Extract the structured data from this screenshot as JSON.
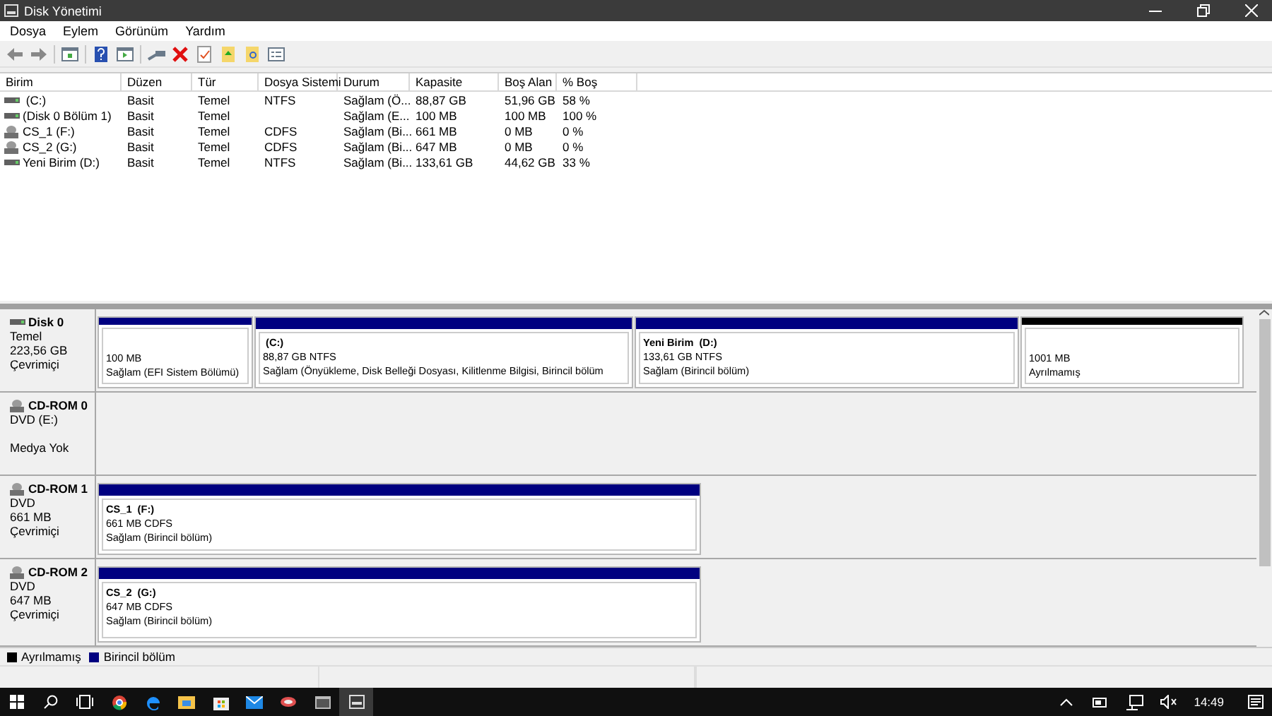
{
  "window": {
    "title": "Disk Yönetimi"
  },
  "menu": [
    "Dosya",
    "Eylem",
    "Görünüm",
    "Yardım"
  ],
  "volume_table": {
    "columns": [
      "Birim",
      "Düzen",
      "Tür",
      "Dosya Sistemi",
      "Durum",
      "Kapasite",
      "Boş Alan",
      "% Boş"
    ],
    "rows": [
      {
        "kind": "disk",
        "cells": [
          " (C:)",
          "Basit",
          "Temel",
          "NTFS",
          "Sağlam (Ö...",
          "88,87 GB",
          "51,96 GB",
          "58 %"
        ]
      },
      {
        "kind": "disk",
        "cells": [
          "(Disk 0 Bölüm 1)",
          "Basit",
          "Temel",
          null,
          "Sağlam (E...",
          "100 MB",
          "100 MB",
          "100 %"
        ]
      },
      {
        "kind": "cd",
        "cells": [
          "CS_1 (F:)",
          "Basit",
          "Temel",
          "CDFS",
          "Sağlam (Bi...",
          "661 MB",
          "0 MB",
          "0 %"
        ]
      },
      {
        "kind": "cd",
        "cells": [
          "CS_2 (G:)",
          "Basit",
          "Temel",
          "CDFS",
          "Sağlam (Bi...",
          "647 MB",
          "0 MB",
          "0 %"
        ]
      },
      {
        "kind": "disk",
        "cells": [
          "Yeni Birim (D:)",
          "Basit",
          "Temel",
          "NTFS",
          "Sağlam (Bi...",
          "133,61 GB",
          "44,62 GB",
          "33 %"
        ]
      }
    ]
  },
  "disks": [
    {
      "kind": "disk",
      "name": "Disk 0",
      "lines": [
        "Temel",
        "223,56 GB",
        "Çevrimiçi"
      ],
      "partitions": [
        {
          "kind": "primary",
          "size": "100 MB",
          "status": "Sağlam (EFI Sistem Bölümü)"
        },
        {
          "kind": "primary",
          "title": " (C:)",
          "size": "88,87 GB NTFS",
          "status": "Sağlam (Önyükleme, Disk Belleği Dosyası, Kilitlenme Bilgisi, Birincil bölüm"
        },
        {
          "kind": "primary",
          "title": "Yeni Birim  (D:)",
          "size": "133,61 GB NTFS",
          "status": "Sağlam (Birincil bölüm)"
        },
        {
          "kind": "unallocated",
          "size": "1001 MB",
          "status": "Ayrılmamış"
        }
      ]
    },
    {
      "kind": "cd",
      "name": "CD-ROM 0",
      "lines": [
        "DVD (E:)"
      ],
      "note": "Medya Yok"
    },
    {
      "kind": "cd",
      "name": "CD-ROM 1",
      "lines": [
        "DVD",
        "661 MB",
        "Çevrimiçi"
      ],
      "partitions": [
        {
          "kind": "primary",
          "title": "CS_1  (F:)",
          "size": "661 MB CDFS",
          "status": "Sağlam (Birincil bölüm)"
        }
      ]
    },
    {
      "kind": "cd",
      "name": "CD-ROM 2",
      "lines": [
        "DVD",
        "647 MB",
        "Çevrimiçi"
      ],
      "partitions": [
        {
          "kind": "primary",
          "title": "CS_2  (G:)",
          "size": "647 MB CDFS",
          "status": "Sağlam (Birincil bölüm)"
        }
      ]
    }
  ],
  "legend": [
    {
      "label": "Ayrılmamış",
      "color": "#000000"
    },
    {
      "label": "Birincil bölüm",
      "color": "#000080"
    }
  ],
  "taskbar": {
    "clock": "14:49"
  }
}
